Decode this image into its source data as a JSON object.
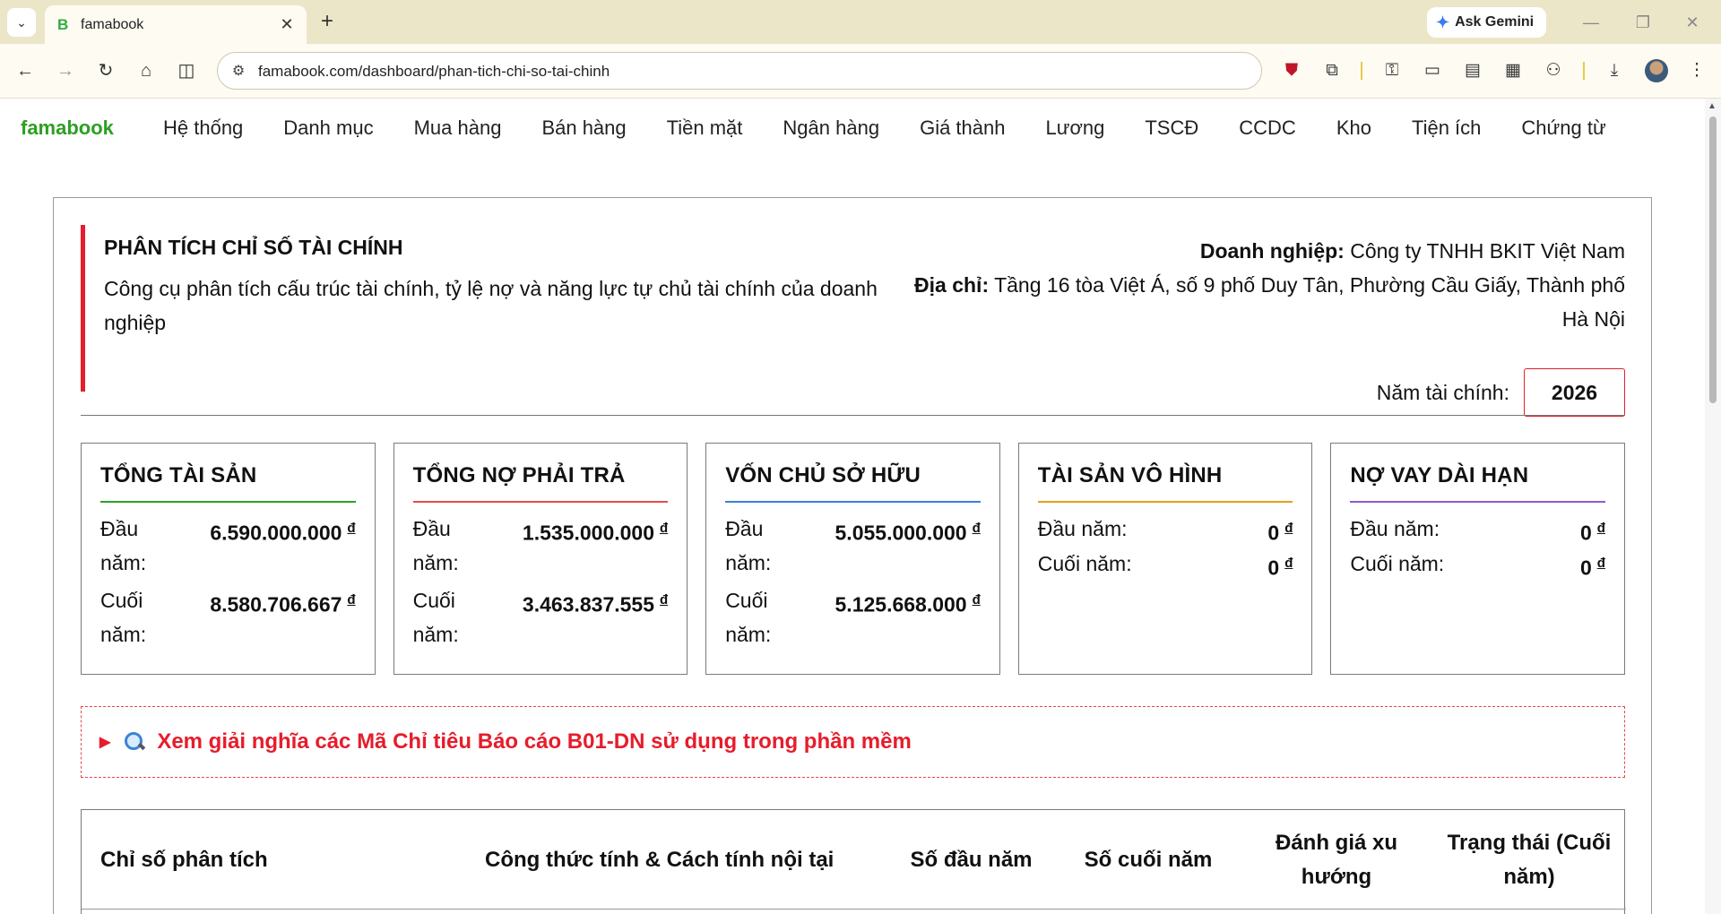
{
  "browser": {
    "tab_title": "famabook",
    "favicon_letter": "B",
    "url": "famabook.com/dashboard/phan-tich-chi-so-tai-chinh",
    "ask_gemini": "Ask Gemini"
  },
  "nav": {
    "brand": "famabook",
    "items": [
      "Hệ thống",
      "Danh mục",
      "Mua hàng",
      "Bán hàng",
      "Tiền mặt",
      "Ngân hàng",
      "Giá thành",
      "Lương",
      "TSCĐ",
      "CCDC",
      "Kho",
      "Tiện ích",
      "Chứng từ"
    ]
  },
  "header": {
    "title": "PHÂN TÍCH CHỈ SỐ TÀI CHÍNH",
    "description": "Công cụ phân tích cấu trúc tài chính, tỷ lệ nợ và năng lực tự chủ tài chính của doanh nghiệp",
    "company_label": "Doanh nghiệp:",
    "company": "Công ty TNHH BKIT Việt Nam",
    "address_label": "Địa chỉ:",
    "address": "Tầng 16 tòa Việt Á, số 9 phố Duy Tân, Phường Cầu Giấy, Thành phố Hà Nội",
    "fiscal_year_label": "Năm tài chính:",
    "fiscal_year": "2026"
  },
  "kpis": [
    {
      "title": "TỔNG TÀI SẢN",
      "color": "#2d9f22",
      "start_label": "Đầu năm:",
      "start_value": "6.590.000.000",
      "end_label": "Cuối năm:",
      "end_value": "8.580.706.667",
      "currency": "đ"
    },
    {
      "title": "TỔNG NỢ PHẢI TRẢ",
      "color": "#e14c4c",
      "start_label": "Đầu năm:",
      "start_value": "1.535.000.000",
      "end_label": "Cuối năm:",
      "end_value": "3.463.837.555",
      "currency": "đ"
    },
    {
      "title": "VỐN CHỦ SỞ HỮU",
      "color": "#3d7fd9",
      "start_label": "Đầu năm:",
      "start_value": "5.055.000.000",
      "end_label": "Cuối năm:",
      "end_value": "5.125.668.000",
      "currency": "đ"
    },
    {
      "title": "TÀI SẢN VÔ HÌNH",
      "color": "#e0a21b",
      "start_label": "Đầu năm:",
      "start_value": "0",
      "end_label": "Cuối năm:",
      "end_value": "0",
      "currency": "đ"
    },
    {
      "title": "NỢ VAY DÀI HẠN",
      "color": "#8a5cd6",
      "start_label": "Đầu năm:",
      "start_value": "0",
      "end_label": "Cuối năm:",
      "end_value": "0",
      "currency": "đ"
    }
  ],
  "glossary": {
    "text": "Xem giải nghĩa các Mã Chỉ tiêu Báo cáo B01-DN sử dụng trong phần mềm"
  },
  "table": {
    "headers": [
      "Chỉ số phân tích",
      "Công thức tính & Cách tính nội tại",
      "Số đầu năm",
      "Số cuối năm",
      "Đánh giá xu hướng",
      "Trạng thái (Cuối năm)"
    ]
  }
}
